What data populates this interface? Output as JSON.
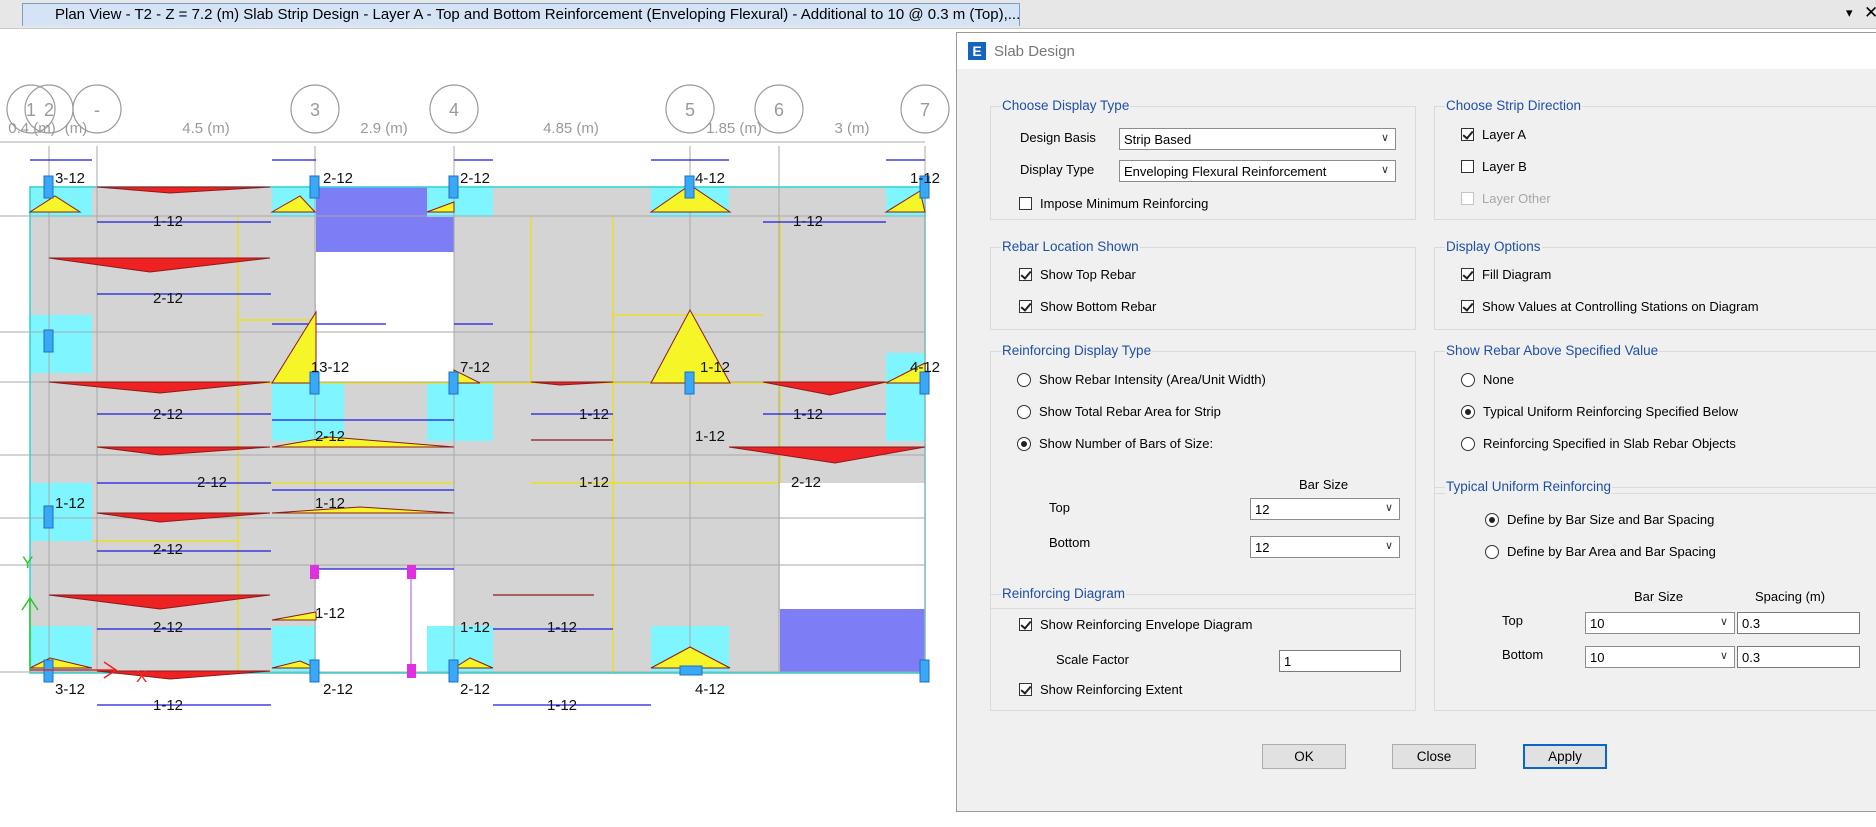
{
  "window": {
    "tab_title": "Plan View - T2 - Z = 7.2 (m)  Slab Strip Design - Layer A - Top and Bottom Reinforcement (Enveloping Flexural)  - Additional to 10 @ 0.3 m (Top),...",
    "menu_glyph": "▾",
    "close_glyph": "✕"
  },
  "plan": {
    "grid_bubbles": [
      "1",
      "2",
      "-",
      "3",
      "4",
      "5",
      "6",
      "7"
    ],
    "dimensions": [
      "0.4 (m)",
      "(m)",
      "4.5 (m)",
      "2.9 (m)",
      "4.85 (m)",
      "1.85 (m)",
      "3 (m)"
    ],
    "axis_y_label": "Y",
    "axis_x_label": "X",
    "rebar_labels": [
      "3-12",
      "2-12",
      "2-12",
      "4-12",
      "1-12",
      "1-12",
      "1-12",
      "2-12",
      "13-12",
      "7-12",
      "1-12",
      "4-12",
      "2-12",
      "1-12",
      "1-12",
      "2-12",
      "1-12",
      "2-12",
      "1-12",
      "2-12",
      "1-12",
      "1-12",
      "2-12",
      "1-12",
      "2-12",
      "1-12",
      "1-12",
      "3-12",
      "2-12",
      "2-12",
      "4-12",
      "1-12",
      "1-12"
    ]
  },
  "dialog": {
    "title": "Slab Design",
    "app_icon_letter": "E",
    "display_type_group": {
      "label": "Choose Display Type",
      "design_basis_label": "Design Basis",
      "design_basis_value": "Strip Based",
      "display_type_label": "Display Type",
      "display_type_value": "Enveloping Flexural Reinforcement",
      "impose_min_label": "Impose Minimum Reinforcing",
      "impose_min_checked": false
    },
    "strip_direction_group": {
      "label": "Choose Strip Direction",
      "items": [
        {
          "label": "Layer A",
          "checked": true,
          "enabled": true
        },
        {
          "label": "Layer B",
          "checked": false,
          "enabled": true
        },
        {
          "label": "Layer Other",
          "checked": false,
          "enabled": false
        }
      ]
    },
    "rebar_location_group": {
      "label": "Rebar Location Shown",
      "items": [
        {
          "label": "Show Top Rebar",
          "checked": true
        },
        {
          "label": "Show Bottom Rebar",
          "checked": true
        }
      ]
    },
    "display_options_group": {
      "label": "Display Options",
      "items": [
        {
          "label": "Fill Diagram",
          "checked": true
        },
        {
          "label": "Show Values at Controlling Stations on Diagram",
          "checked": true
        }
      ]
    },
    "reinforcing_display_group": {
      "label": "Reinforcing Display Type",
      "options": [
        {
          "label": "Show Rebar Intensity (Area/Unit Width)",
          "selected": false
        },
        {
          "label": "Show Total Rebar Area for Strip",
          "selected": false
        },
        {
          "label": "Show Number of Bars of Size:",
          "selected": true
        }
      ],
      "bar_size_header": "Bar Size",
      "top_label": "Top",
      "top_value": "12",
      "bottom_label": "Bottom",
      "bottom_value": "12"
    },
    "show_rebar_above_group": {
      "label": "Show Rebar Above Specified Value",
      "options": [
        {
          "label": "None",
          "selected": false
        },
        {
          "label": "Typical Uniform Reinforcing Specified Below",
          "selected": true
        },
        {
          "label": "Reinforcing Specified in Slab Rebar Objects",
          "selected": false
        }
      ]
    },
    "typical_uniform_group": {
      "label": "Typical Uniform Reinforcing",
      "options": [
        {
          "label": "Define by Bar Size and Bar Spacing",
          "selected": true
        },
        {
          "label": "Define by Bar Area and Bar Spacing",
          "selected": false
        }
      ],
      "bar_size_header": "Bar Size",
      "spacing_header": "Spacing  (m)",
      "top_label": "Top",
      "top_bar": "10",
      "top_spacing": "0.3",
      "bottom_label": "Bottom",
      "bottom_bar": "10",
      "bottom_spacing": "0.3"
    },
    "reinforcing_diagram_group": {
      "label": "Reinforcing Diagram",
      "envelope_label": "Show Reinforcing Envelope Diagram",
      "envelope_checked": true,
      "scale_factor_label": "Scale Factor",
      "scale_factor_value": "1",
      "extent_label": "Show Reinforcing Extent",
      "extent_checked": true
    },
    "buttons": {
      "ok": "OK",
      "close": "Close",
      "apply": "Apply"
    }
  },
  "colors": {
    "cyan_zone": "#7ff6ff",
    "blue_zone": "#7d7df5",
    "slab_gray": "#d4d4d4",
    "top_diagram": "#ee2222",
    "bottom_diagram": "#f5f527",
    "accent_blue": "#1f4fa8"
  }
}
